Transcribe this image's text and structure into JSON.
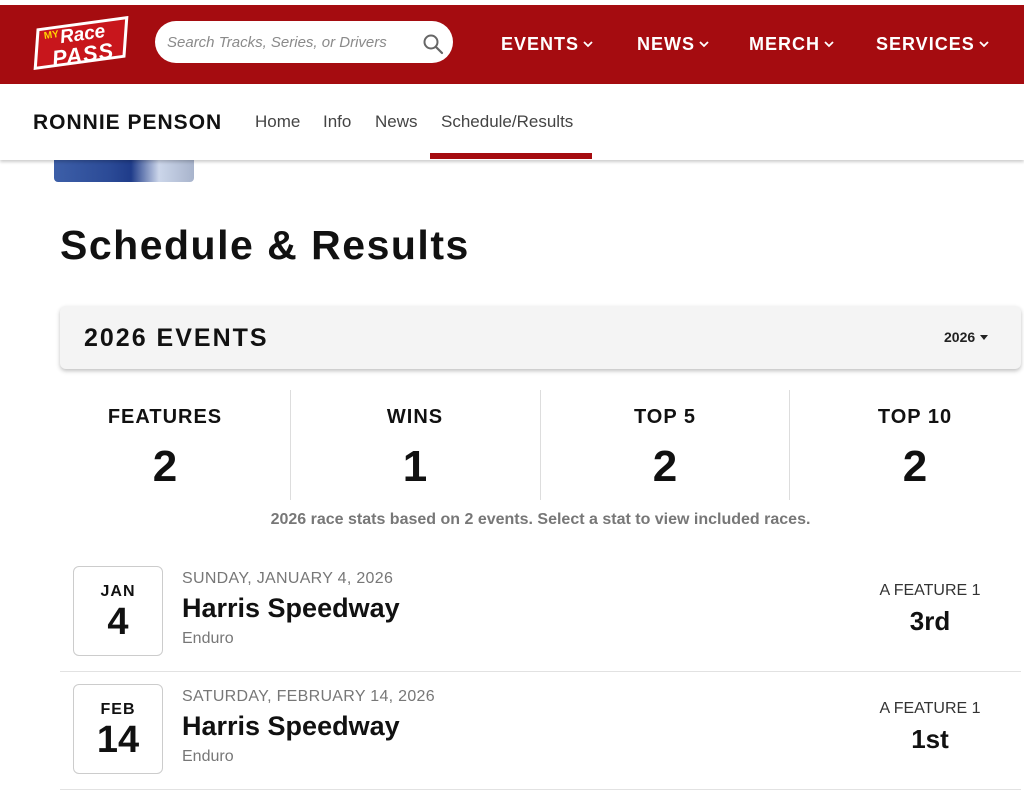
{
  "header": {
    "logo": {
      "my": "MY",
      "race": "Race",
      "pass": "PASS"
    },
    "search_placeholder": "Search Tracks, Series, or Drivers",
    "nav": [
      {
        "label": "EVENTS"
      },
      {
        "label": "NEWS"
      },
      {
        "label": "MERCH"
      },
      {
        "label": "SERVICES"
      }
    ]
  },
  "subnav": {
    "driver_name": "RONNIE PENSON",
    "links": [
      "Home",
      "Info",
      "News",
      "Schedule/Results"
    ],
    "active": "Schedule/Results"
  },
  "page": {
    "title": "Schedule & Results",
    "events_title": "2026 EVENTS",
    "year": "2026"
  },
  "stats": [
    {
      "label": "FEATURES",
      "value": "2"
    },
    {
      "label": "WINS",
      "value": "1"
    },
    {
      "label": "TOP 5",
      "value": "2"
    },
    {
      "label": "TOP 10",
      "value": "2"
    }
  ],
  "stats_note": "2026 race stats based on 2 events. Select a stat to view included races.",
  "races": [
    {
      "month": "JAN",
      "day": "4",
      "date": "SUNDAY, JANUARY 4, 2026",
      "track": "Harris Speedway",
      "class": "Enduro",
      "event": "A FEATURE 1",
      "finish": "3rd"
    },
    {
      "month": "FEB",
      "day": "14",
      "date": "SATURDAY, FEBRUARY 14, 2026",
      "track": "Harris Speedway",
      "class": "Enduro",
      "event": "A FEATURE 1",
      "finish": "1st"
    }
  ],
  "colors": {
    "brand_red": "#a50c10",
    "active_underline": "#a50c10"
  }
}
